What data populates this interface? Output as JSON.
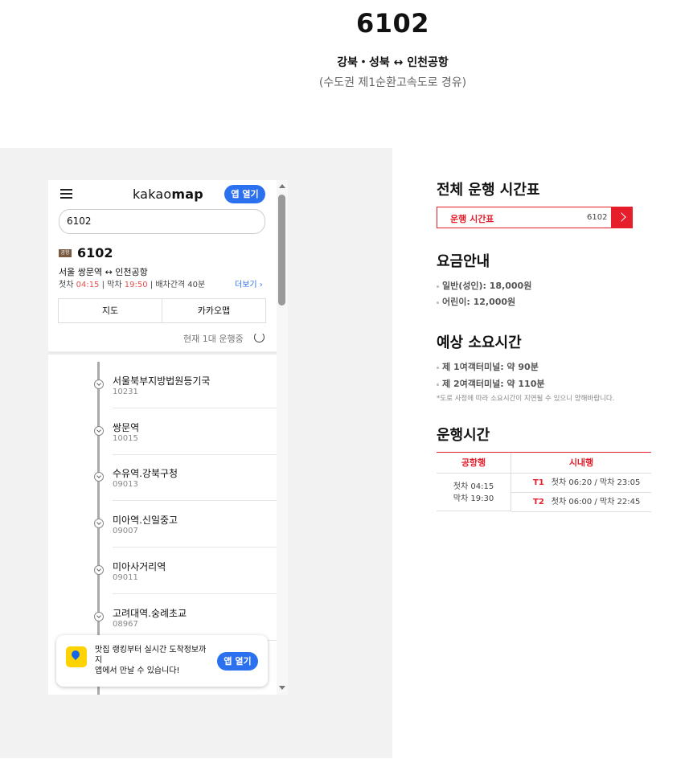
{
  "page": {
    "route_number": "6102",
    "route_title": "강북・성북 ↔ 인천공항",
    "route_subtitle": "(수도권 제1순환고속도로 경유)"
  },
  "map_app": {
    "logo": "kakao",
    "logo_bold": "map",
    "open_app_label": "앱 열기",
    "search_value": "6102",
    "badge": "공항",
    "bus_number": "6102",
    "bus_route": "서울 쌍문역 ↔ 인천공항",
    "first_label": "첫차",
    "first_time": "04:15",
    "last_label": "막차",
    "last_time": "19:50",
    "interval": "배차간격 40분",
    "more_label": "더보기 ›",
    "tabs": [
      "지도",
      "카카오맵"
    ],
    "running_status": "현재 1대 운행중",
    "stops": [
      {
        "name": "서울북부지방법원등기국",
        "code": "10231"
      },
      {
        "name": "쌍문역",
        "code": "10015"
      },
      {
        "name": "수유역.강북구청",
        "code": "09013"
      },
      {
        "name": "미아역.신일중고",
        "code": "09007"
      },
      {
        "name": "미아사거리역",
        "code": "09011"
      },
      {
        "name": "고려대역.숭례초교",
        "code": "08967"
      }
    ],
    "popup": {
      "text": "맛집 랭킹부터 실시간 도착정보까지\n앱에서 만날 수 있습니다!",
      "button": "앱 열기"
    }
  },
  "info": {
    "timetable_title": "전체 운행 시간표",
    "timetable_button_label": "운행 시간표",
    "timetable_button_num": "6102",
    "fare_title": "요금안내",
    "fare_adult": "일반(성인): 18,000원",
    "fare_child": "어린이: 12,000원",
    "duration_title": "예상 소요시간",
    "duration_t1": "제 1여객터미널: 약 90분",
    "duration_t2": "제 2여객터미널: 약 110분",
    "duration_note": "*도로 사정에 따라 소요시간이 지연될 수 있으니 양해바랍니다.",
    "hours_title": "운행시간",
    "col_airbound": "공항행",
    "col_citybound": "시내행",
    "airbound_first": "첫차 04:15",
    "airbound_last": "막차 19:30",
    "t1_label": "T1",
    "t1_times": "첫차 06:20 / 막차 23:05",
    "t2_label": "T2",
    "t2_times": "첫차 06:00 / 막차 22:45"
  },
  "colors": {
    "accent": "#e61e2b",
    "kakao_blue": "#2b70ee",
    "panel_bg": "#f2f2f2"
  }
}
